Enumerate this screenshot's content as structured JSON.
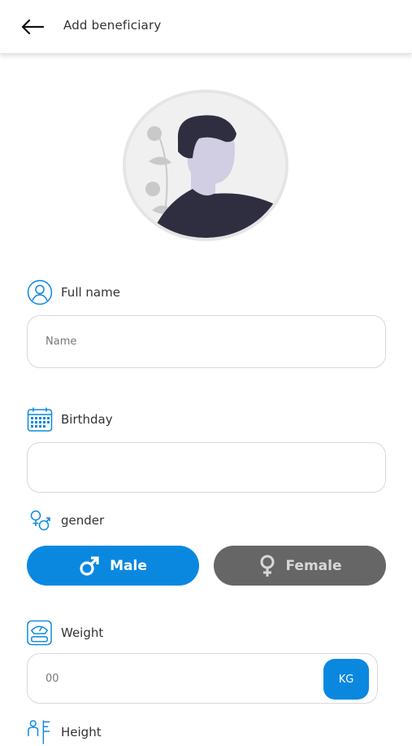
{
  "header": {
    "title": "Add beneficiary",
    "back_icon": "arrow-left-icon"
  },
  "avatar": {
    "icon": "user-avatar-placeholder"
  },
  "full_name": {
    "label": "Full name",
    "icon": "user-circle-icon",
    "placeholder": "Name",
    "value": ""
  },
  "birthday": {
    "label": "Birthday",
    "icon": "calendar-icon",
    "value": ""
  },
  "gender": {
    "label": "gender",
    "icon": "gender-icon",
    "options": [
      {
        "label": "Male",
        "icon": "male-icon",
        "selected": true
      },
      {
        "label": "Female",
        "icon": "female-icon",
        "selected": false
      }
    ]
  },
  "weight": {
    "label": "Weight",
    "icon": "scale-icon",
    "placeholder": "00",
    "unit": "KG"
  },
  "height": {
    "label": "Height",
    "icon": "height-icon"
  },
  "colors": {
    "primary": "#0a88e0",
    "inactive": "#666666",
    "border": "#d8d8d8"
  }
}
